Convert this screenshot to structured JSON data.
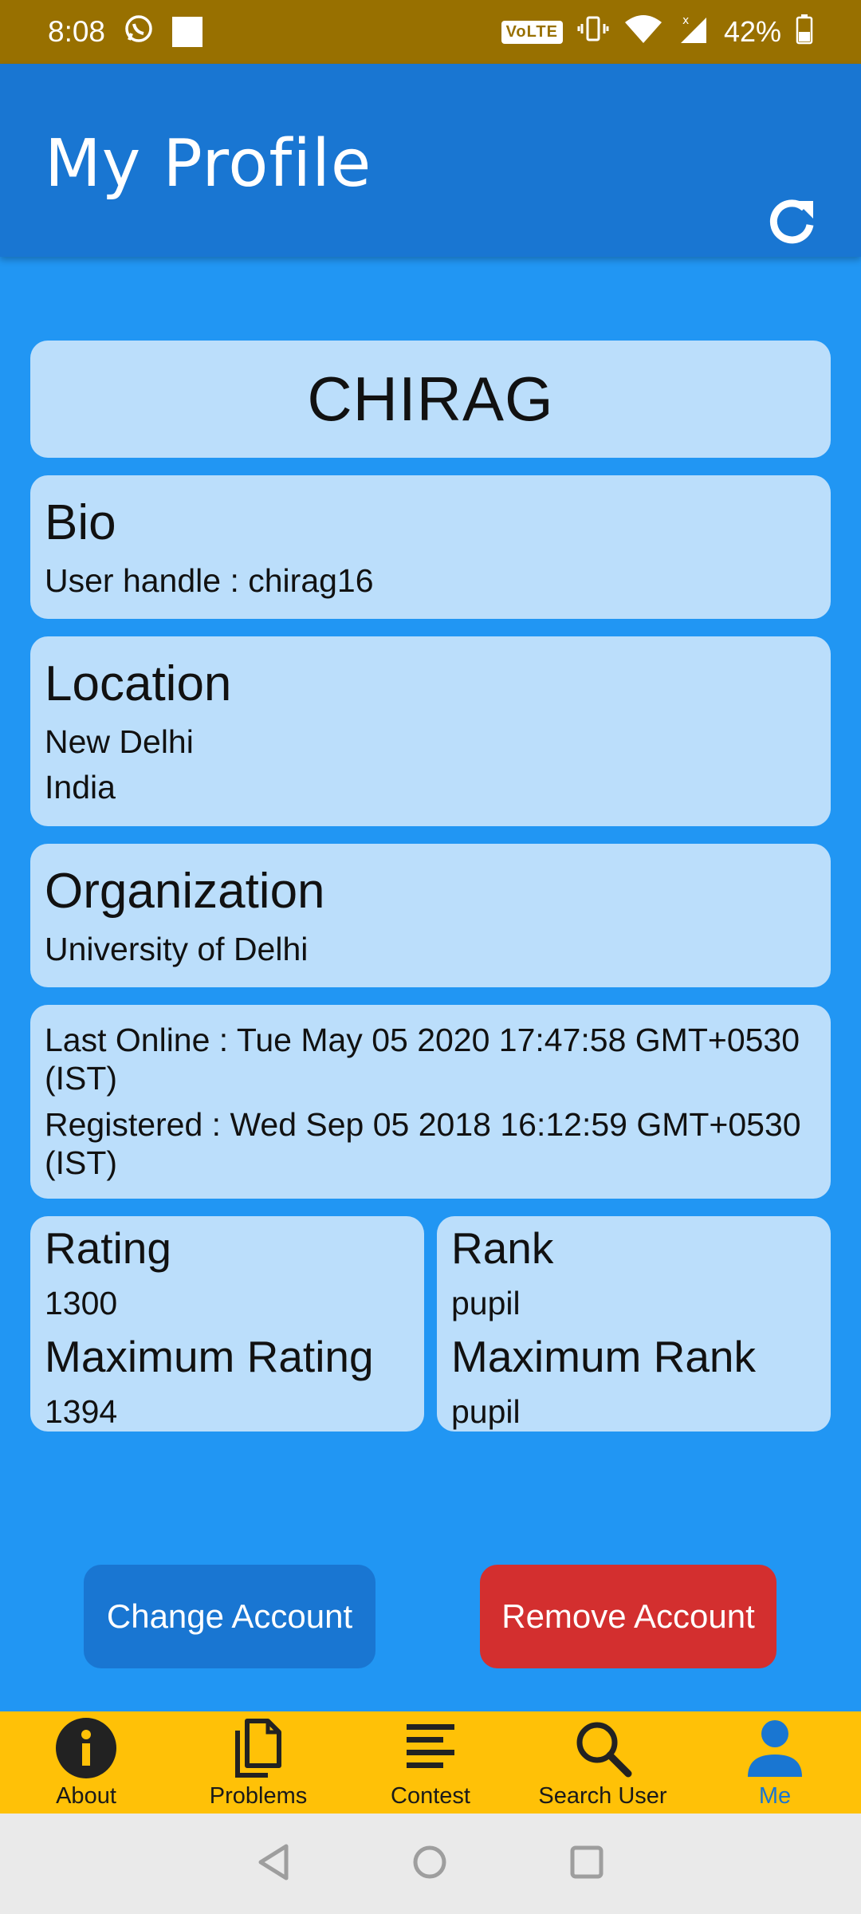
{
  "status_bar": {
    "time": "8:08",
    "volte": "VoLTE",
    "battery": "42%"
  },
  "app_bar": {
    "title": "My Profile"
  },
  "profile": {
    "name": "CHIRAG",
    "bio": {
      "heading": "Bio",
      "handle_line": "User handle : chirag16"
    },
    "location": {
      "heading": "Location",
      "city": "New Delhi",
      "country": "India"
    },
    "organization": {
      "heading": "Organization",
      "name": "University of Delhi"
    },
    "activity": {
      "last_online_line1": "Last Online : Tue May 05 2020 17:47:58 GMT+0530",
      "last_online_line2": "(IST)",
      "registered_line1": "Registered : Wed Sep 05 2018 16:12:59 GMT+0530",
      "registered_line2": "(IST)"
    },
    "rating": {
      "heading": "Rating",
      "value": "1300",
      "max_heading": "Maximum Rating",
      "max_value": "1394"
    },
    "rank": {
      "heading": "Rank",
      "value": "pupil",
      "max_heading": "Maximum Rank",
      "max_value": "pupil"
    }
  },
  "actions": {
    "change_account": "Change Account",
    "remove_account": "Remove Account"
  },
  "bottom_nav": {
    "items": [
      {
        "label": "About",
        "icon": "info-icon"
      },
      {
        "label": "Problems",
        "icon": "documents-icon"
      },
      {
        "label": "Contest",
        "icon": "list-icon"
      },
      {
        "label": "Search User",
        "icon": "search-icon"
      },
      {
        "label": "Me",
        "icon": "person-icon"
      }
    ],
    "active": "Me"
  },
  "colors": {
    "status_bar": "#987000",
    "app_bar": "#1976D2",
    "background": "#2196F3",
    "card": "#BBDEFB",
    "remove_button": "#D32F2F",
    "bottom_nav": "#FFC107"
  }
}
